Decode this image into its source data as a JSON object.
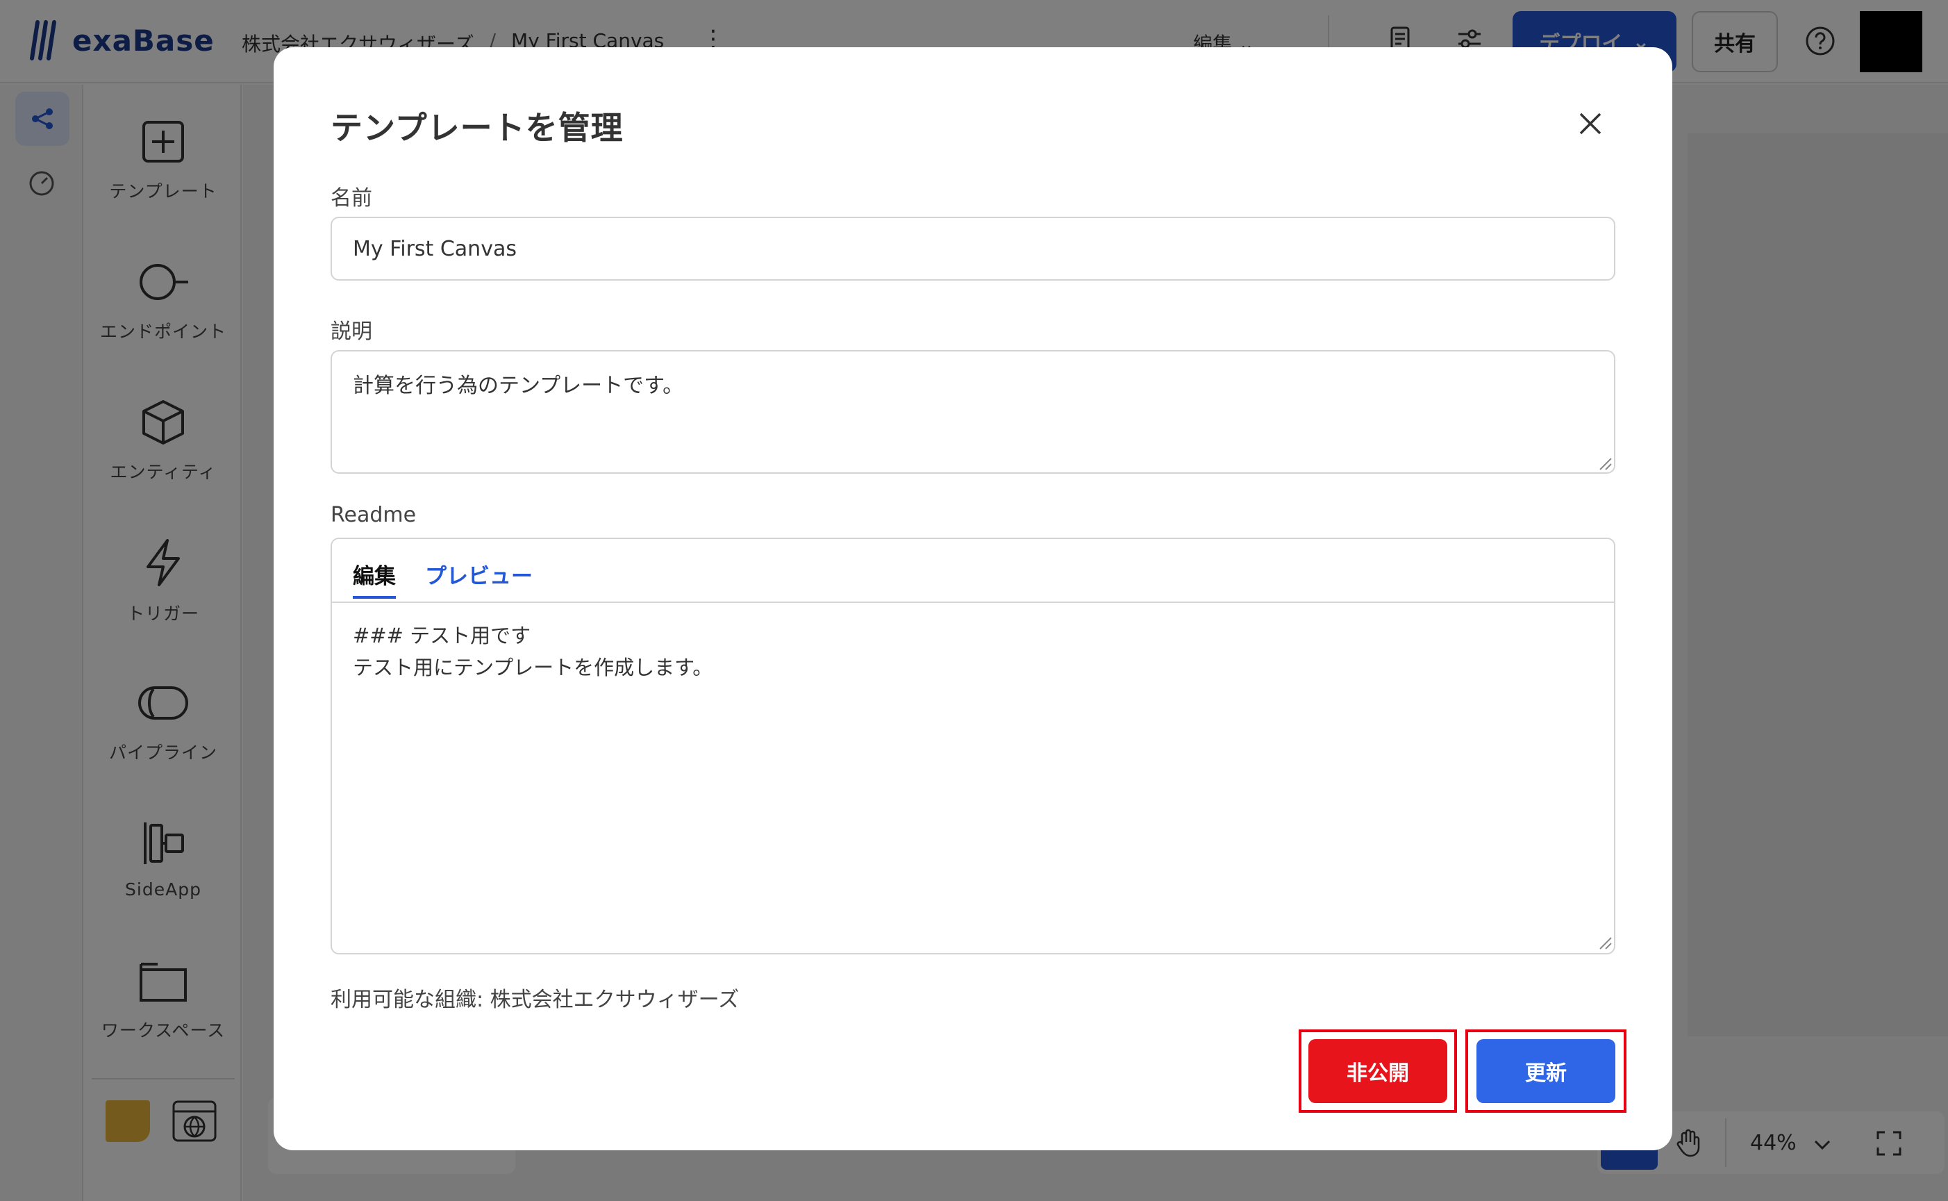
{
  "app": {
    "logo_text": "exaBase",
    "breadcrumb": [
      "株式会社エクサウィザーズ",
      "My First Canvas"
    ],
    "breadcrumb_sep": "/",
    "mode_label": "編集",
    "deploy_label": "デプロイ",
    "share_label": "共有",
    "zoom_value": "44%"
  },
  "palette": {
    "items": [
      {
        "label": "テンプレート",
        "icon": "plus-square-icon"
      },
      {
        "label": "エンドポイント",
        "icon": "endpoint-icon"
      },
      {
        "label": "エンティティ",
        "icon": "cube-icon"
      },
      {
        "label": "トリガー",
        "icon": "lightning-icon"
      },
      {
        "label": "パイプライン",
        "icon": "pipeline-icon"
      },
      {
        "label": "SideApp",
        "icon": "sideapp-icon"
      },
      {
        "label": "ワークスペース",
        "icon": "workspace-icon"
      }
    ]
  },
  "modal": {
    "title": "テンプレートを管理",
    "name_label": "名前",
    "name_value": "My First Canvas",
    "desc_label": "説明",
    "desc_value": "計算を行う為のテンプレートです。",
    "readme_label": "Readme",
    "tab_edit": "編集",
    "tab_preview": "プレビュー",
    "readme_value": "### テスト用です\nテスト用にテンプレートを作成します。",
    "org_line": "利用可能な組織: 株式会社エクサウィザーズ",
    "unpublish_label": "非公開",
    "update_label": "更新",
    "colors": {
      "unpublish": "#e8141c",
      "update": "#2f66e8",
      "highlight": "#e60012"
    }
  }
}
